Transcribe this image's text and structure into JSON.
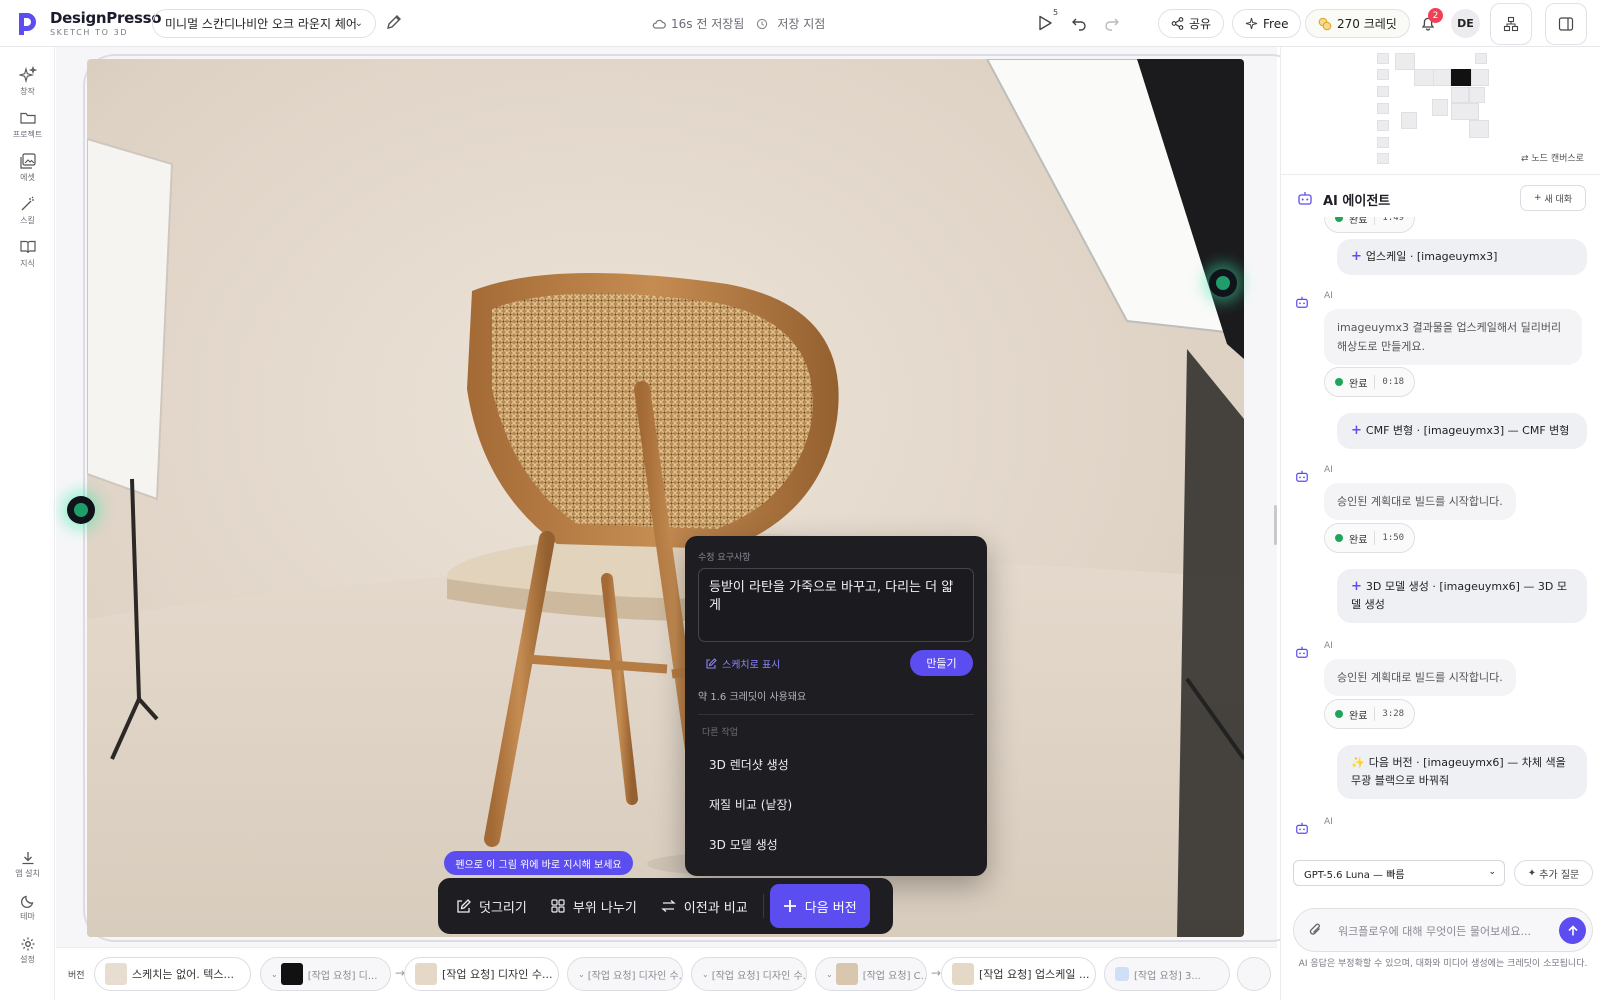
{
  "app": {
    "name": "DesignPresso",
    "tagline": "SKETCH TO 3D"
  },
  "header": {
    "project_title": "미니멀 스칸디나비안 오크 라운지 체어",
    "save_time": "16s 전 저장됨",
    "save_point": "저장 지점",
    "play_count": "5",
    "share_label": "공유",
    "plan_label": "Free",
    "credits_label": "270 크레딧",
    "notification_count": "2",
    "avatar_initials": "DE"
  },
  "rail": [
    {
      "label": "창작",
      "icon": "sparkle-icon"
    },
    {
      "label": "프로젝트",
      "icon": "folder-icon"
    },
    {
      "label": "에셋",
      "icon": "image-stack-icon"
    },
    {
      "label": "스킬",
      "icon": "wand-icon"
    },
    {
      "label": "지식",
      "icon": "book-icon"
    },
    {
      "label": "앱 설치",
      "icon": "download-icon"
    },
    {
      "label": "테마",
      "icon": "moon-icon"
    },
    {
      "label": "설정",
      "icon": "gear-icon"
    }
  ],
  "popover": {
    "label": "수정 요구사항",
    "input_value": "등받이 라탄을 가죽으로 바꾸고, 다리는 더 얇게",
    "sketch_link": "스케치로 표시",
    "make_button": "만들기",
    "cost_note": "약 1.6 크레딧이 사용돼요",
    "other_title": "다른 작업",
    "items": [
      "3D 렌더샷 생성",
      "재질 비교 (낱장)",
      "3D 모델 생성"
    ]
  },
  "hint": "펜으로 이 그림 위에 바로 지시해 보세요",
  "actionbar": {
    "draw": "덧그리기",
    "split": "부위 나누기",
    "compare": "이전과 비교",
    "next": "다음 버전"
  },
  "versions": {
    "label": "버전",
    "chips": [
      "스케치는 없어. 텍스...",
      "[작업 요청] 디...",
      "[작업 요청] 디자인 수...",
      "[작업 요청] 디자인 수...",
      "[작업 요청] 디자인 수...",
      "[작업 요청] C...",
      "[작업 요청] 업스케일 ...",
      "[작업 요청] 3..."
    ]
  },
  "minimap": {
    "link": "노드 캔버스로"
  },
  "agent": {
    "title": "AI 에이전트",
    "new_chat": "새 대화",
    "ai_tag": "AI",
    "done": "완료",
    "messages": {
      "u1": "업스케일 · [imageuymx3]",
      "a1": "imageuymx3 결과물을 업스케일해서 딜리버리 해상도로 만들게요.",
      "t1": "0:18",
      "u2": "CMF 변형 · [imageuymx3] — CMF 변형",
      "a2": "승인된 계획대로 빌드를 시작합니다.",
      "t2": "1:50",
      "u3": "3D 모델 생성 · [imageuymx6] — 3D 모델 생성",
      "a3": "승인된 계획대로 빌드를 시작합니다.",
      "t3": "3:28",
      "u4": "다음 버전 · [imageuymx6] — 차체 색을 무광 블랙으로 바꿔줘"
    },
    "model": "GPT-5.6 Luna — 빠름",
    "add_question": "추가 질문",
    "placeholder": "워크플로우에 대해 무엇이든 물어보세요...",
    "disclaimer": "AI 응답은 부정확할 수 있으며, 대화와 미디어 생성에는 크레딧이 소모됩니다."
  },
  "colors": {
    "accent": "#5b4df0",
    "popover_bg": "#1d1d22",
    "success": "#1fa55a"
  }
}
